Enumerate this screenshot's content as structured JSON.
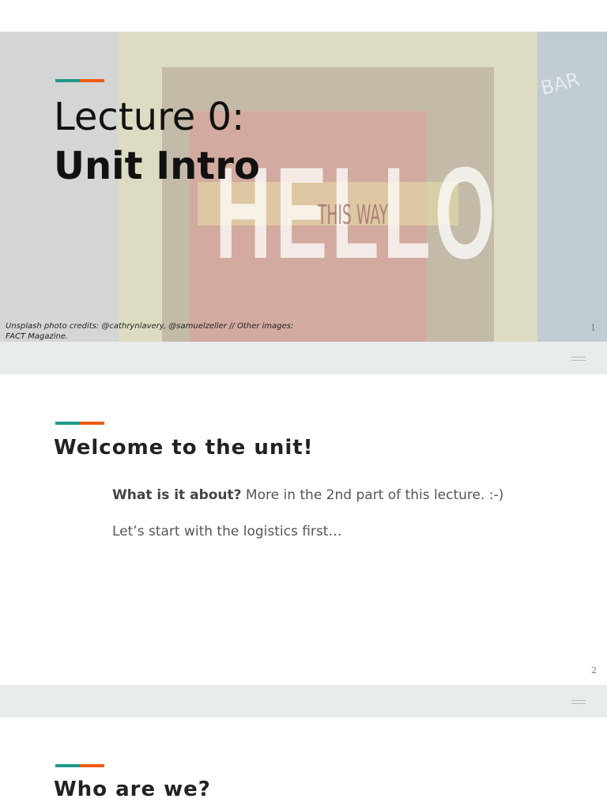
{
  "slides": [
    {
      "number": "1",
      "title_line1": "Lecture 0:",
      "title_line2": "Unit Intro",
      "credits": "Unsplash photo credits: @cathrynlavery, @samuelzeller // Other images: FACT Magazine.",
      "photo_text": {
        "hello": "HELLO",
        "this_way": "THIS WAY",
        "bar": "BAR"
      }
    },
    {
      "number": "2",
      "heading": "Welcome to the unit!",
      "line1_bold": "What is it about?",
      "line1_rest": " More in the 2nd part of this lecture. :-)",
      "line2": "Let’s start with the logistics first…"
    },
    {
      "heading": "Who are we?"
    }
  ],
  "colors": {
    "accent_teal": "#1e9a8a",
    "accent_orange": "#f05a14"
  }
}
